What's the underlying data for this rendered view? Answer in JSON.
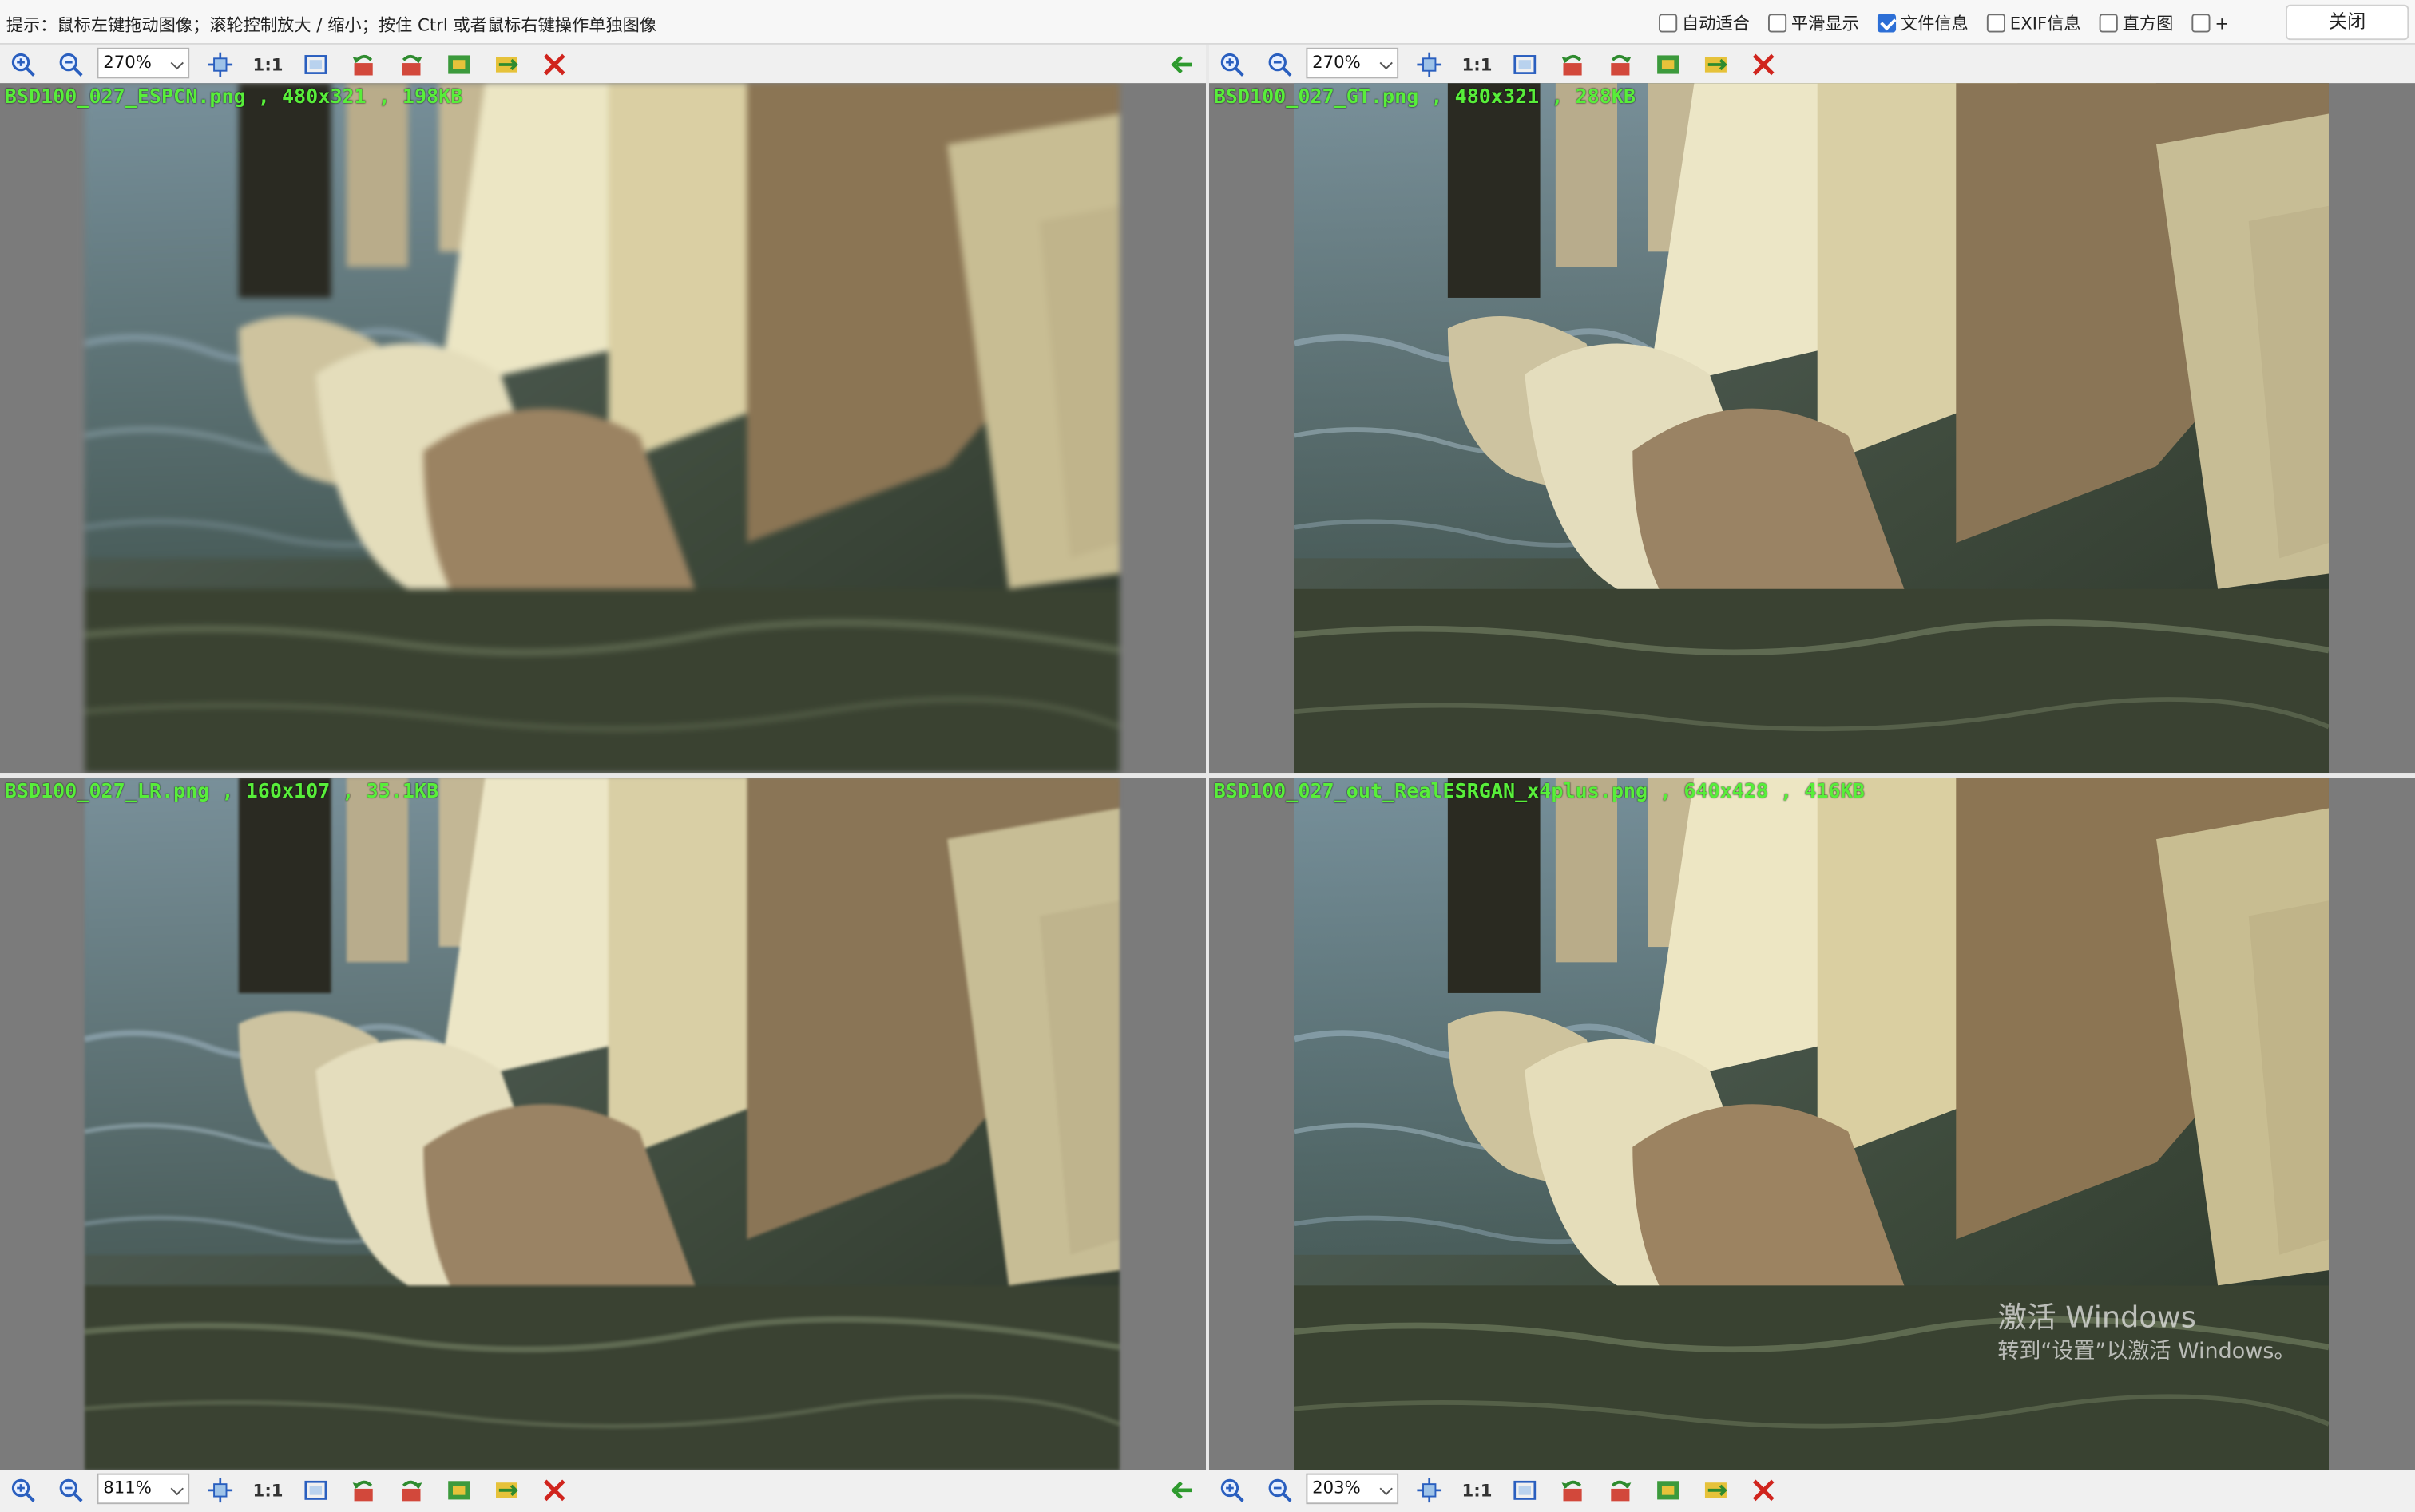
{
  "hint": "提示：鼠标左键拖动图像；滚轮控制放大 / 缩小；按住 Ctrl 或者鼠标右键操作单独图像",
  "options": [
    {
      "label": "自动适合",
      "checked": false
    },
    {
      "label": "平滑显示",
      "checked": false
    },
    {
      "label": "文件信息",
      "checked": true
    },
    {
      "label": "EXIF信息",
      "checked": false
    },
    {
      "label": "直方图",
      "checked": false
    },
    {
      "label": "+",
      "checked": false
    }
  ],
  "close_label": "关闭",
  "toolbar_one_to_one": "1:1",
  "panes": {
    "top_left": {
      "caption": "BSD100_027_ESPCN.png , 480x321 , 198KB",
      "zoom": "270%"
    },
    "top_right": {
      "caption": "BSD100_027_GT.png , 480x321 , 288KB",
      "zoom": "270%"
    },
    "bottom_left": {
      "caption": "BSD100_027_LR.png , 160x107 , 35.1KB",
      "zoom": "811%"
    },
    "bottom_right": {
      "caption": "BSD100_027_out_RealESRGAN_x4plus.png , 640x428 , 416KB",
      "zoom": "203%"
    }
  },
  "watermark": {
    "line1": "激活 Windows",
    "line2": "转到“设置”以激活 Windows。"
  },
  "colors": {
    "caption": "#58ee3a",
    "view_bg": "#7b7b7b",
    "close_x": "#d0241d",
    "accent": "#2d6fd6"
  },
  "icons": [
    "zoom-in-icon",
    "zoom-out-icon",
    "fit-icon",
    "one-to-one",
    "frame-icon",
    "rotate-left-icon",
    "rotate-right-icon",
    "flip-icon",
    "swap-icon",
    "close-x-icon",
    "prev-arrow-icon"
  ]
}
